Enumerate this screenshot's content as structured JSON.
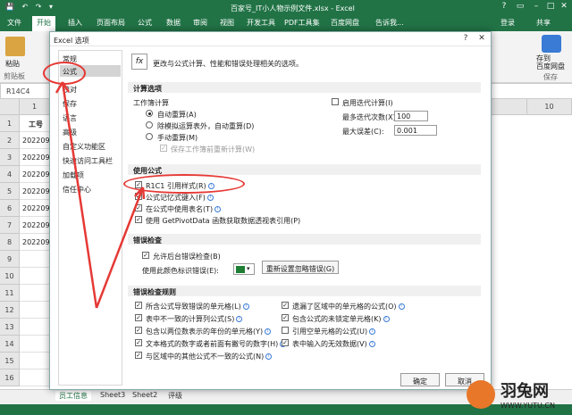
{
  "titlebar": {
    "title": "百家号_IT小人物示例文件.xlsx - Excel",
    "qat_icons": [
      "save-icon",
      "undo-icon",
      "redo-icon"
    ],
    "controls": [
      "?",
      "▭",
      "–",
      "□",
      "✕"
    ]
  },
  "ribbon_tabs": [
    "文件",
    "开始",
    "插入",
    "页面布局",
    "公式",
    "数据",
    "审阅",
    "视图",
    "开发工具",
    "PDF工具集",
    "百度网盘",
    "告诉我...",
    "登录",
    "共享"
  ],
  "ribbon": {
    "left_label": "粘贴",
    "left_sub": "剪贴板",
    "right_label": "存到\n百度网盘",
    "right_sub": "保存"
  },
  "namebox": "R14C4",
  "columns": [
    "1",
    "",
    "",
    "",
    "",
    "",
    "",
    "",
    "",
    "",
    "10"
  ],
  "row_headers": [
    "1",
    "2",
    "3",
    "4",
    "5",
    "6",
    "7",
    "8",
    "9",
    "10",
    "11",
    "12",
    "13",
    "14",
    "15",
    "16"
  ],
  "cells": [
    "工号",
    "2022090",
    "2022090",
    "2022090",
    "2022090",
    "2022090",
    "2022090",
    "2022090",
    "",
    "",
    "",
    "",
    "",
    "",
    "",
    ""
  ],
  "sheet_tabs": [
    "员工信息",
    "Sheet3",
    "Sheet2",
    "评级"
  ],
  "dialog": {
    "title": "Excel 选项",
    "help": "?",
    "close": "✕",
    "nav": [
      "常规",
      "公式",
      "校对",
      "保存",
      "语言",
      "高级",
      "自定义功能区",
      "快速访问工具栏",
      "加载项",
      "信任中心"
    ],
    "selected_nav": "公式",
    "header_text": "更改与公式计算、性能和错误处理相关的选项。",
    "calc": {
      "section": "计算选项",
      "workbook_label": "工作簿计算",
      "options": [
        "自动重算(A)",
        "除模拟运算表外，自动重算(D)",
        "手动重算(M)"
      ],
      "recalc_before_save": "保存工作簿前重新计算(W)",
      "iterative": "启用迭代计算(I)",
      "max_iter_label": "最多迭代次数(X):",
      "max_iter_value": "100",
      "max_change_label": "最大误差(C):",
      "max_change_value": "0.001"
    },
    "formulas": {
      "section": "使用公式",
      "items": [
        "R1C1 引用样式(R)",
        "公式记忆式键入(F)",
        "在公式中使用表名(T)",
        "使用 GetPivotData 函数获取数据透视表引用(P)"
      ]
    },
    "errcheck": {
      "section": "错误检查",
      "enable": "允许后台错误检查(B)",
      "color_label": "使用此颜色标识错误(E):",
      "reset": "重新设置忽略错误(G)"
    },
    "rules": {
      "section": "错误检查规则",
      "left": [
        "所含公式导致错误的单元格(L)",
        "表中不一致的计算列公式(S)",
        "包含以两位数表示的年份的单元格(Y)",
        "文本格式的数字或者前面有撇号的数字(H)",
        "与区域中的其他公式不一致的公式(N)"
      ],
      "right": [
        "遗漏了区域中的单元格的公式(O)",
        "包含公式的未锁定单元格(K)",
        "引用空单元格的公式(U)",
        "表中输入的无效数据(V)"
      ]
    },
    "ok": "确定",
    "cancel": "取消"
  },
  "watermark": {
    "brand": "羽兔网",
    "url": "WWW.YUTU.CN"
  },
  "colors": {
    "excel_green": "#217346",
    "annotation_red": "#e53935",
    "watermark_orange": "#e8772a"
  }
}
